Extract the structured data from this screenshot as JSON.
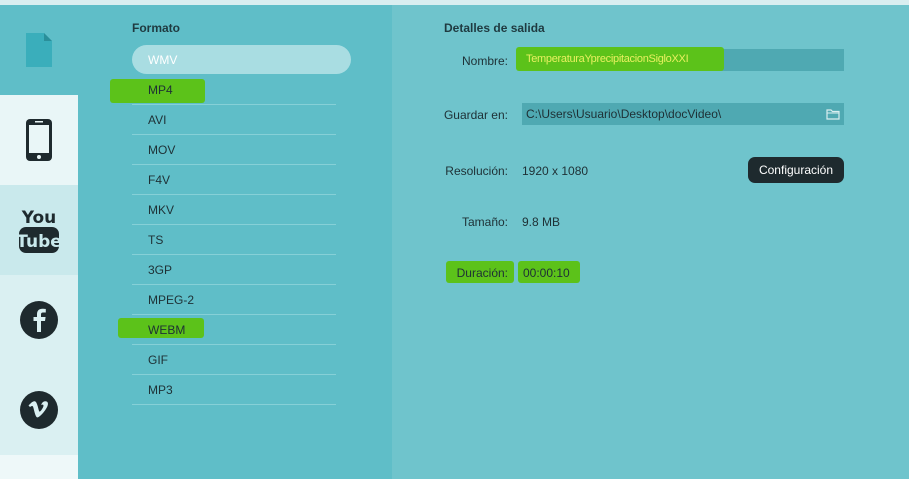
{
  "sidebar": {
    "items": [
      {
        "name": "file-icon",
        "active": true
      },
      {
        "name": "phone-icon",
        "active": false
      },
      {
        "name": "youtube-icon",
        "active": false
      },
      {
        "name": "facebook-icon",
        "active": false
      },
      {
        "name": "vimeo-icon",
        "active": false
      }
    ],
    "youtube_top": "You",
    "youtube_bottom": "Tube"
  },
  "format": {
    "title": "Formato",
    "selected": "WMV",
    "items": [
      "WMV",
      "MP4",
      "AVI",
      "MOV",
      "F4V",
      "MKV",
      "TS",
      "3GP",
      "MPEG-2",
      "WEBM",
      "GIF",
      "MP3"
    ],
    "highlighted": [
      "MP4",
      "WEBM"
    ]
  },
  "details": {
    "title": "Detalles de salida",
    "name_label": "Nombre:",
    "name_value": "TemperaturaYprecipitacionSigloXXI",
    "save_label": "Guardar en:",
    "save_value": "C:\\Users\\Usuario\\Desktop\\docVideo\\",
    "resolution_label": "Resolución:",
    "resolution_value": "1920 x 1080",
    "config_button": "Configuración",
    "size_label": "Tamaño:",
    "size_value": "9.8 MB",
    "duration_label": "Duración:",
    "duration_value": "00:00:10"
  },
  "colors": {
    "highlight": "#5cc21a",
    "panel": "#5fbec8",
    "details_bg": "#6fc4cc",
    "button": "#1e2a2e"
  }
}
